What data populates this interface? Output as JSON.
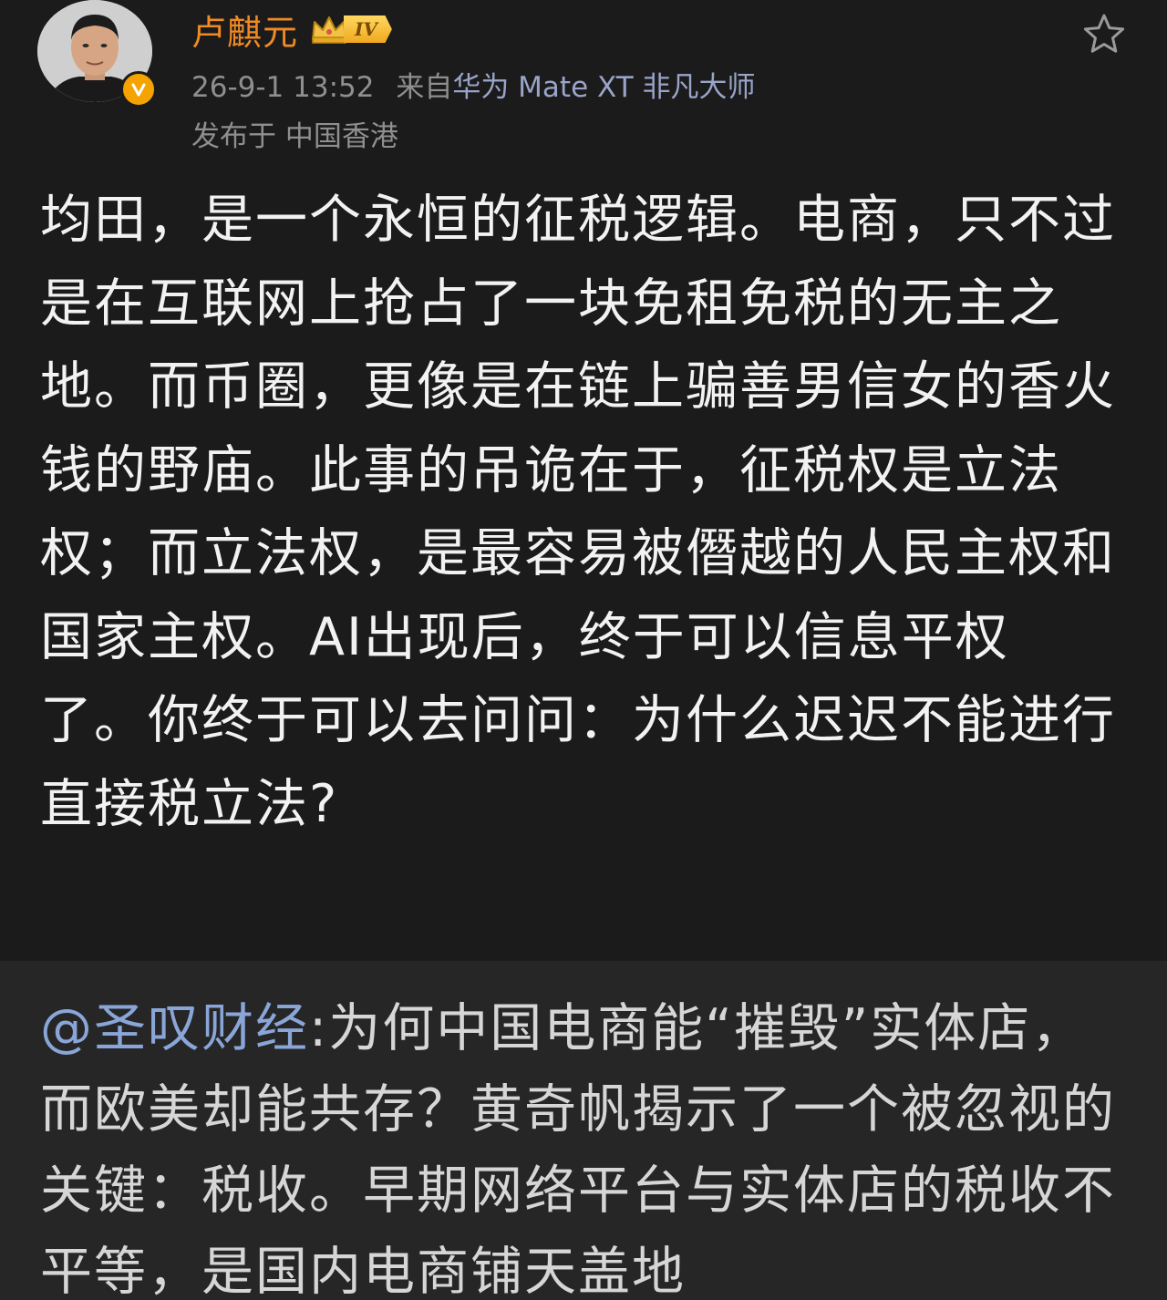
{
  "user": {
    "name": "卢麒元",
    "level": "IV",
    "timestamp": "26-9-1 13:52",
    "source_prefix": "来自",
    "device": "华为 Mate XT 非凡大师",
    "location": "发布于 中国香港"
  },
  "post": {
    "text": "均田，是一个永恒的征税逻辑。电商，只不过是在互联网上抢占了一块免租免税的无主之地。而币圈，更像是在链上骗善男信女的香火钱的野庙。此事的吊诡在于，征税权是立法权；而立法权，是最容易被僭越的人民主权和国家主权。AI出现后，终于可以信息平权了。你终于可以去问问：为什么迟迟不能进行直接税立法?"
  },
  "repost": {
    "mention": "@圣叹财经",
    "text": ":为何中国电商能“摧毁”实体店，而欧美却能共存？黄奇帆揭示了一个被忽视的关键：税收。早期网络平台与实体店的税收不平等，是国内电商铺天盖地"
  },
  "icons": {
    "favorite": "star-outline-icon",
    "verified": "verified-v-icon",
    "level": "crown-icon"
  },
  "colors": {
    "background": "#1b1b1b",
    "repost_background": "#262626",
    "username": "#f08a24",
    "mention": "#8aa6d8",
    "body_text": "#f2f2f2",
    "meta_text": "#8f8f8f"
  }
}
